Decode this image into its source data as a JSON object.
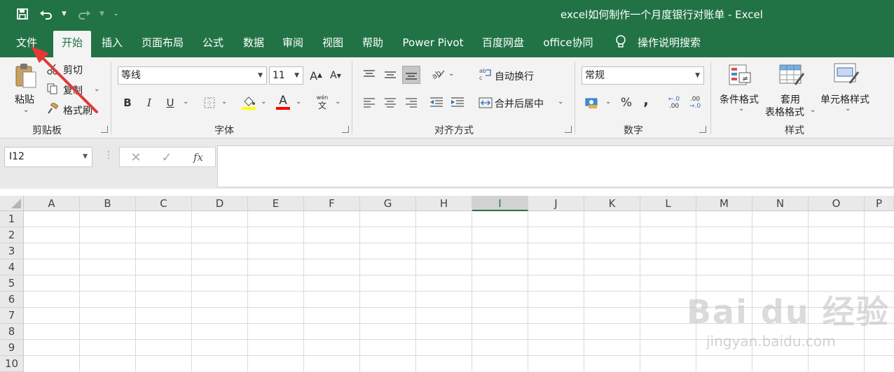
{
  "window": {
    "title": "excel如何制作一个月度银行对账单 - Excel"
  },
  "tabs": [
    "文件",
    "开始",
    "插入",
    "页面布局",
    "公式",
    "数据",
    "审阅",
    "视图",
    "帮助",
    "Power Pivot",
    "百度网盘",
    "office协同",
    "操作说明搜索"
  ],
  "clipboard": {
    "paste": "粘贴",
    "cut": "剪切",
    "copy": "复制",
    "format_painter": "格式刷",
    "label": "剪贴板"
  },
  "font": {
    "name": "等线",
    "size": "11",
    "bold": "B",
    "italic": "I",
    "underline": "U",
    "phonetic_top": "wén",
    "phonetic_bottom": "文",
    "grow": "A",
    "shrink": "A",
    "label": "字体",
    "fill_color": "#ffff00",
    "font_color": "#ff0000"
  },
  "alignment": {
    "wrap": "自动换行",
    "merge": "合并后居中",
    "label": "对齐方式"
  },
  "number": {
    "format": "常规",
    "percent": "%",
    "comma": ",",
    "inc_decimal": ".00",
    "dec_decimal": ".0",
    "label": "数字"
  },
  "styles": {
    "conditional": "条件格式",
    "table_format_1": "套用",
    "table_format_2": "表格格式",
    "cell_styles": "单元格样式",
    "label": "样式"
  },
  "formula_bar": {
    "name_box": "I12",
    "fx": "fx"
  },
  "grid": {
    "columns": [
      "A",
      "B",
      "C",
      "D",
      "E",
      "F",
      "G",
      "H",
      "I",
      "J",
      "K",
      "L",
      "M",
      "N",
      "O",
      "P"
    ],
    "rows": [
      "1",
      "2",
      "3",
      "4",
      "5",
      "6",
      "7",
      "8",
      "9",
      "10"
    ],
    "selected_column": "I"
  },
  "watermark": {
    "brand": "Bai du 经验",
    "url": "jingyan.baidu.com"
  },
  "colors": {
    "accent": "#217346",
    "annotation": "#e53935"
  }
}
